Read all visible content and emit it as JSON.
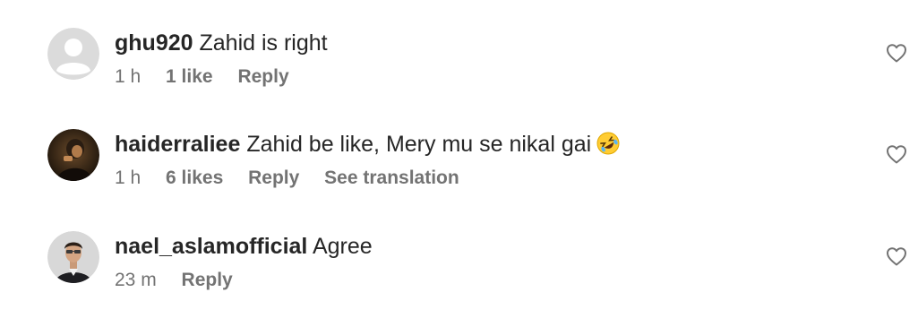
{
  "comments": [
    {
      "username": "ghu920",
      "text": "Zahid is right",
      "time": "1 h",
      "likes": "1 like",
      "reply": "Reply",
      "avatar_icon": "default-user-icon"
    },
    {
      "username": "haiderraliee",
      "text": "Zahid be like, Mery mu se nikal gai",
      "emoji": "rolling-on-floor-laughing-emoji",
      "time": "1 h",
      "likes": "6 likes",
      "reply": "Reply",
      "translation": "See translation",
      "avatar_icon": "profile-photo"
    },
    {
      "username": "nael_aslamofficial",
      "text": "Agree",
      "time": "23 m",
      "reply": "Reply",
      "avatar_icon": "profile-photo"
    }
  ],
  "colors": {
    "text": "#262626",
    "secondary": "#737373",
    "default_avatar_bg": "#dbdbdb",
    "default_avatar_fg": "#ffffff"
  }
}
